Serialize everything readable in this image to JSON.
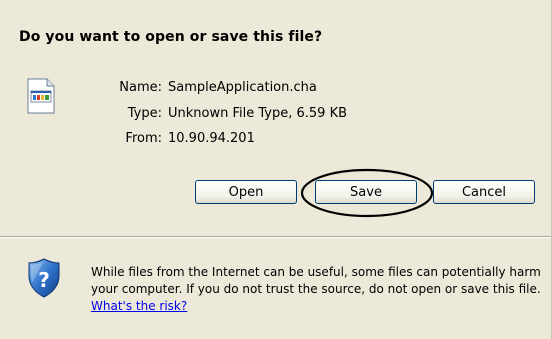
{
  "dialog": {
    "title": "Do you want to open or save this file?",
    "file_icon": "file-document-icon",
    "fields": {
      "name_label": "Name:",
      "name_value": "SampleApplication.cha",
      "type_label": "Type:",
      "type_value": "Unknown File Type, 6.59 KB",
      "from_label": "From:",
      "from_value": "10.90.94.201"
    },
    "buttons": {
      "open": "Open",
      "save": "Save",
      "cancel": "Cancel"
    },
    "warning": {
      "icon": "shield-question-icon",
      "text": "While files from the Internet can be useful, some files can potentially harm your computer. If you do not trust the source, do not open or save this file. ",
      "link": "What's the risk?"
    },
    "colors": {
      "background": "#ece9d8",
      "button_border": "#003c74",
      "link": "#0000ee",
      "annotation": "#000000"
    }
  }
}
